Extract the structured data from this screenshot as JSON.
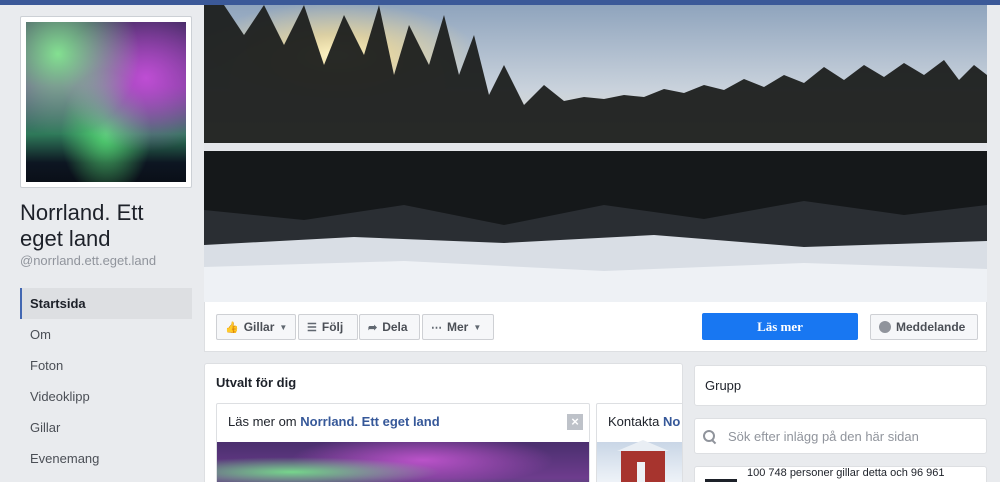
{
  "page": {
    "name": "Norrland. Ett eget land",
    "handle": "@norrland.ett.eget.land"
  },
  "nav": {
    "items": [
      {
        "label": "Startsida",
        "active": true
      },
      {
        "label": "Om"
      },
      {
        "label": "Foton"
      },
      {
        "label": "Videoklipp"
      },
      {
        "label": "Gillar"
      },
      {
        "label": "Evenemang"
      }
    ]
  },
  "actions": {
    "like": "Gillar",
    "follow": "Följ",
    "share": "Dela",
    "more": "Mer",
    "learn_more": "Läs mer",
    "message": "Meddelande"
  },
  "featured": {
    "title": "Utvalt för dig",
    "card1_prefix": "Läs mer om",
    "card1_link": "Norrland. Ett eget land",
    "card2_prefix": "Kontakta",
    "card2_link": "No"
  },
  "sidebar": {
    "group": "Grupp",
    "search_placeholder": "Sök efter inlägg på den här sidan",
    "likes_text": "100 748 personer gillar detta och 96 961"
  },
  "colors": {
    "brand": "#3b5998",
    "primary_button": "#1877f2",
    "link": "#365899"
  }
}
